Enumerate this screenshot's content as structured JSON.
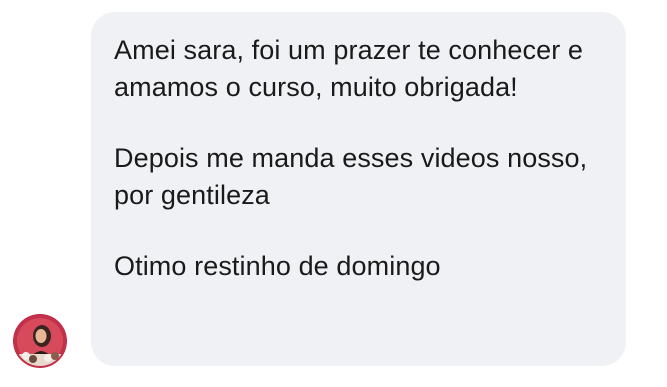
{
  "message": {
    "paragraphs": [
      "Amei sara, foi um prazer te conhecer e amamos o curso, muito obrigada!",
      "Depois me manda esses videos nosso, por gentileza",
      "Otimo restinho de domingo"
    ]
  },
  "colors": {
    "bubble_background": "#f0f1f4",
    "text": "#1a1a1a",
    "avatar_ring": "#c2304a"
  }
}
